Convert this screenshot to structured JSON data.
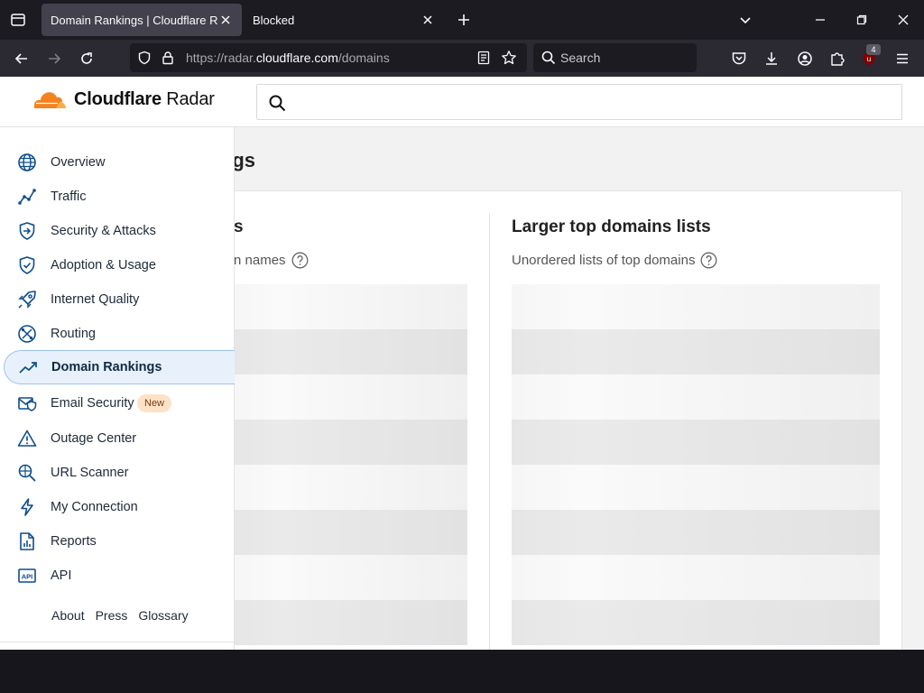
{
  "browser": {
    "tabs": [
      {
        "title": "Domain Rankings | Cloudflare Radar",
        "active": true
      },
      {
        "title": "Blocked",
        "active": false
      }
    ],
    "url": {
      "scheme": "https://",
      "subdomain": "radar.",
      "host": "cloudflare.com",
      "path": "/domains"
    },
    "search_placeholder": "Search",
    "ublock_count": "4"
  },
  "site": {
    "logo_bold": "Cloudflare",
    "logo_rest": " Radar",
    "search_value": "",
    "colors": {
      "brand_orange": "#f6821f",
      "active_nav_bg": "#e8f1fb"
    }
  },
  "sidebar": {
    "items": [
      {
        "label": "Overview",
        "icon": "globe-icon"
      },
      {
        "label": "Traffic",
        "icon": "traffic-chart-icon"
      },
      {
        "label": "Security & Attacks",
        "icon": "shield-arrow-icon"
      },
      {
        "label": "Adoption & Usage",
        "icon": "shield-check-icon"
      },
      {
        "label": "Internet Quality",
        "icon": "rocket-icon"
      },
      {
        "label": "Routing",
        "icon": "routing-icon"
      },
      {
        "label": "Domain Rankings",
        "icon": "trend-up-icon",
        "active": true
      },
      {
        "label": "Email Security",
        "icon": "email-shield-icon",
        "badge": "New"
      },
      {
        "label": "Outage Center",
        "icon": "warning-icon"
      },
      {
        "label": "URL Scanner",
        "icon": "scan-icon"
      },
      {
        "label": "My Connection",
        "icon": "bolt-icon"
      },
      {
        "label": "Reports",
        "icon": "report-icon"
      },
      {
        "label": "API",
        "icon": "api-icon"
      }
    ],
    "footer": [
      "About",
      "Press",
      "Glossary"
    ]
  },
  "main": {
    "heading_visible": "gs",
    "left": {
      "title_visible": "s",
      "subtitle_visible": "n names"
    },
    "right": {
      "title": "Larger top domains lists",
      "subtitle": "Unordered lists of top domains"
    }
  }
}
